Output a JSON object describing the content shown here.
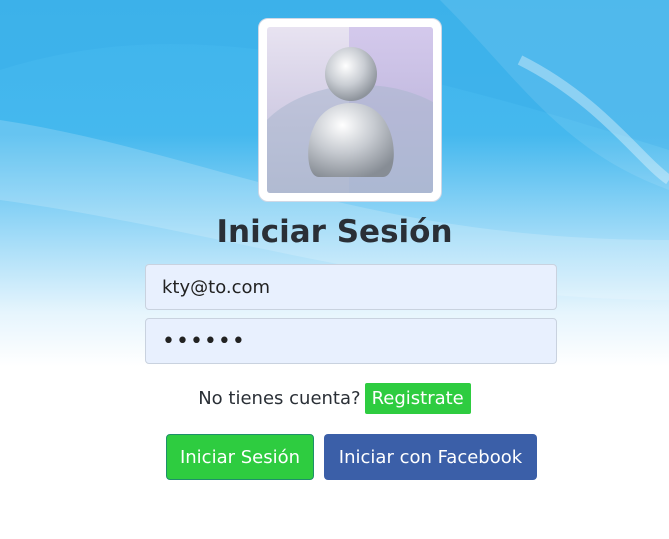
{
  "header": {
    "title": "Iniciar Sesión"
  },
  "form": {
    "email_value": "kty@to.com",
    "password_value": "••••••"
  },
  "register": {
    "prompt": "No tienes cuenta?",
    "link_label": "Registrate"
  },
  "actions": {
    "login_label": "Iniciar Sesión",
    "facebook_label": "Iniciar con Facebook"
  },
  "colors": {
    "accent_green": "#2ecc40",
    "facebook_blue": "#3b5fa8",
    "background_blue": "#3fb4ec"
  },
  "icons": {
    "avatar": "user-silhouette-icon"
  }
}
